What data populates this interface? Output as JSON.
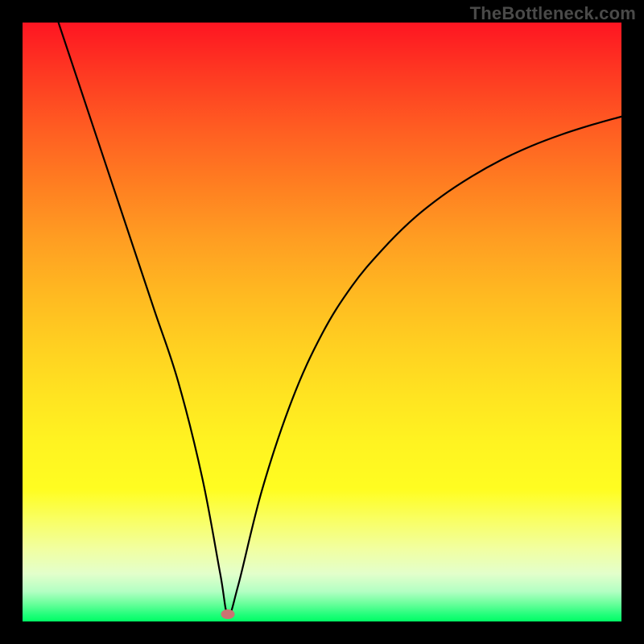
{
  "watermark": "TheBottleneck.com",
  "colors": {
    "marker": "#cb7372",
    "curve": "#000000"
  },
  "chart_data": {
    "type": "line",
    "title": "",
    "xlabel": "",
    "ylabel": "",
    "xlim": [
      0,
      100
    ],
    "ylim": [
      0,
      100
    ],
    "grid": false,
    "series": [
      {
        "name": "bottleneck-curve",
        "x": [
          6,
          10,
          14,
          18,
          22,
          26,
          30,
          33,
          34.3,
          36,
          40,
          45,
          50,
          55,
          60,
          65,
          70,
          75,
          80,
          85,
          90,
          95,
          100
        ],
        "y": [
          100,
          88,
          76,
          64,
          52,
          40,
          24,
          8,
          1.2,
          6,
          22,
          37,
          48,
          56,
          62,
          67,
          71,
          74.3,
          77.1,
          79.4,
          81.3,
          82.9,
          84.3
        ]
      }
    ],
    "marker": {
      "x": 34.3,
      "y": 1.2
    },
    "legend": false
  }
}
